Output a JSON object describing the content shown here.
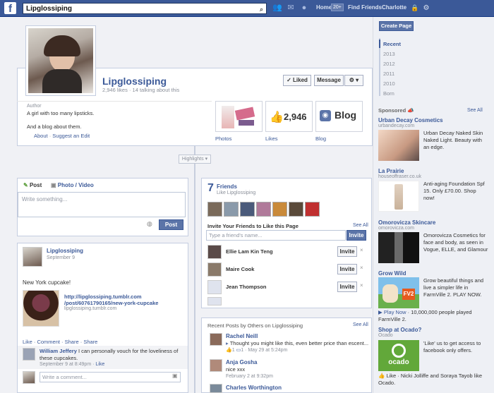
{
  "topbar": {
    "logo": "f",
    "search_value": "Lipglossiping",
    "nav": {
      "home": "Home",
      "home_badge": "20+",
      "find_friends": "Find Friends",
      "user": "Charlotte"
    }
  },
  "page": {
    "name": "Lipglossiping",
    "stats": "2,946 likes · 14 talking about this",
    "liked_label": "✓ Liked",
    "message_label": "Message",
    "gear_label": "⚙ ▾",
    "category": "Author",
    "about_line1": "A girl with too many lipsticks.",
    "about_line2": "And a blog about them.",
    "about_link": "About",
    "suggest_link": "Suggest an Edit",
    "apps": [
      {
        "label": "Photos"
      },
      {
        "label": "Likes",
        "value": "2,946"
      },
      {
        "label": "Blog",
        "value": "Blog"
      }
    ],
    "highlights": "Highlights ▾"
  },
  "composer": {
    "tab_post": "Post",
    "tab_photo": "Photo / Video",
    "placeholder": "Write something...",
    "post_button": "Post"
  },
  "post": {
    "author": "Lipglossiping",
    "date": "September 9",
    "text": "New York cupcake!",
    "link_line1": "http://lipglossiping.tumblr.com",
    "link_line2": "/post/60761790165/new-york-cupcake",
    "link_domain": "lipglossiping.tumblr.com",
    "actions": [
      "Like",
      "Comment",
      "Share"
    ],
    "share_action": "Share",
    "comment_author": "William Jeffery",
    "comment_text": "I can personally vouch for the loveliness of these cupcakes.",
    "comment_meta": "September 9 at 8:49pm",
    "comment_like": "Like",
    "comment_placeholder": "Write a comment..."
  },
  "friends": {
    "count": "7",
    "title": "Friends",
    "subtitle": "Like Lipglossiping",
    "invite_title": "Invite Your Friends to Like this Page",
    "see_all": "See All",
    "invite_placeholder": "Type a friend's name...",
    "invite_btn": "Invite",
    "list": [
      {
        "name": "Ellie Lam Kin Teng",
        "btn": "Invite"
      },
      {
        "name": "Maire Cook",
        "btn": "Invite"
      },
      {
        "name": "Jean Thompson",
        "btn": "Invite"
      }
    ],
    "remove": "×"
  },
  "recent_posts": {
    "title": "Recent Posts by Others on Lipglossiping",
    "see_all": "See All",
    "items": [
      {
        "author": "Rachel Neill",
        "text": "Thought you might like this, even better price than escent...",
        "meta_like": "1",
        "meta_comment": "1",
        "meta_date": "May 29 at 5:24pm"
      },
      {
        "author": "Anja Gosha",
        "text": "nice xxx",
        "meta_date": "February 2 at 9:32pm"
      },
      {
        "author": "Charles Worthington"
      }
    ]
  },
  "rightcol": {
    "create_page": "Create Page",
    "timeline": [
      "Recent",
      "2013",
      "2012",
      "2011",
      "2010",
      "Born"
    ],
    "sponsored": "Sponsored",
    "see_all": "See All",
    "ads": [
      {
        "title": "Urban Decay Cosmetics",
        "domain": "urbandecay.com",
        "text": "Urban Decay Naked Skin Naked Light. Beauty with an edge."
      },
      {
        "title": "La Prairie",
        "domain": "houseoffraser.co.uk",
        "text": "Anti-aging Foundation Spf 15. Only £70.00. Shop now!"
      },
      {
        "title": "Omorovicza Skincare",
        "domain": "omorovicza.com",
        "text": "Omorovicza Cosmetics for face and body, as seen in Vogue, ELLE, and Glamour"
      },
      {
        "title": "Grow Wild",
        "text": "Grow beautiful things and live a simpler life in FarmVille 2. PLAY NOW.",
        "play": "Play Now",
        "play_meta": " · 10,000,000 people played FarmVille 2."
      },
      {
        "title": "Shop at Ocado?",
        "domain": "Ocado",
        "text": "'Like' us to get access to facebook only offers.",
        "like_meta": "Like · Nicki Jolliffe and Soraya Tayob like Ocado.",
        "logo": "ocado"
      }
    ]
  }
}
